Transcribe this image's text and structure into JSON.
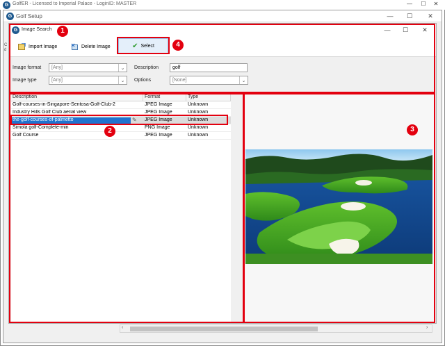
{
  "outer_window": {
    "title": "GolfER - Licensed to Imperial Palace - LoginID: MASTER",
    "icon": "golf-app-icon"
  },
  "setup_window": {
    "title": "Golf Setup",
    "left_edge_chars": [
      "C",
      "d"
    ]
  },
  "search_window": {
    "title": "Image Search"
  },
  "toolbar": {
    "import_label": "Import Image",
    "delete_label": "Delete Image",
    "select_label": "Select"
  },
  "filters": {
    "image_format_label": "Image format",
    "image_format_value": "[Any]",
    "image_type_label": "Image type",
    "image_type_value": "[Any]",
    "description_label": "Description",
    "description_value": "golf",
    "options_label": "Options",
    "options_value": "[None]"
  },
  "grid": {
    "columns": [
      "Description",
      "Format",
      "Type"
    ],
    "rows": [
      [
        "Golf-courses-in-Singapore-Sentosa-Golf-Club-2",
        "JPEG Image",
        "Unknown"
      ],
      [
        "Industry Hills Golf Club aerial view",
        "JPEG Image",
        "Unknown"
      ],
      [
        "the-golf-courses-of-palmetto",
        "JPEG Image",
        "Unknown"
      ],
      [
        "Simola golf-Complete-min",
        "PNG Image",
        "Unknown"
      ],
      [
        "Golf Course",
        "JPEG Image",
        "Unknown"
      ]
    ],
    "selected_index": 2
  },
  "callouts": [
    "1",
    "2",
    "3",
    "4"
  ],
  "colors": {
    "annotation_red": "#e3000f",
    "selection_blue": "#1f73cf"
  }
}
